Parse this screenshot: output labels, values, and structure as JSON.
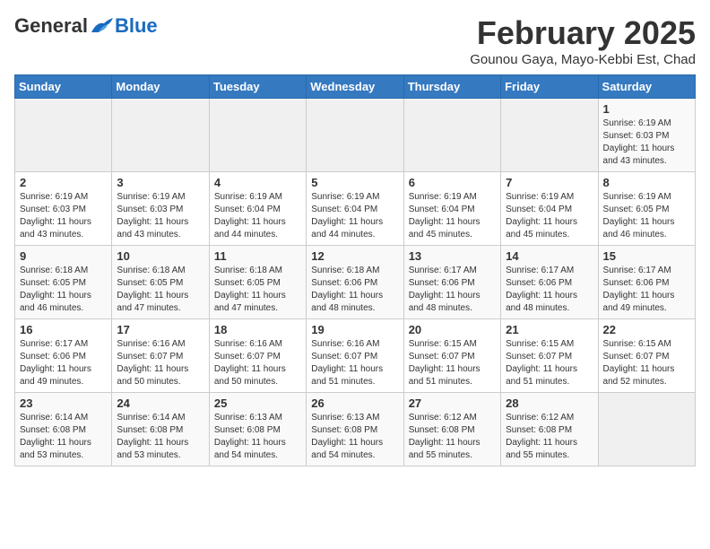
{
  "header": {
    "logo_general": "General",
    "logo_blue": "Blue",
    "month_title": "February 2025",
    "location": "Gounou Gaya, Mayo-Kebbi Est, Chad"
  },
  "weekdays": [
    "Sunday",
    "Monday",
    "Tuesday",
    "Wednesday",
    "Thursday",
    "Friday",
    "Saturday"
  ],
  "weeks": [
    [
      {
        "day": "",
        "info": ""
      },
      {
        "day": "",
        "info": ""
      },
      {
        "day": "",
        "info": ""
      },
      {
        "day": "",
        "info": ""
      },
      {
        "day": "",
        "info": ""
      },
      {
        "day": "",
        "info": ""
      },
      {
        "day": "1",
        "info": "Sunrise: 6:19 AM\nSunset: 6:03 PM\nDaylight: 11 hours\nand 43 minutes."
      }
    ],
    [
      {
        "day": "2",
        "info": "Sunrise: 6:19 AM\nSunset: 6:03 PM\nDaylight: 11 hours\nand 43 minutes."
      },
      {
        "day": "3",
        "info": "Sunrise: 6:19 AM\nSunset: 6:03 PM\nDaylight: 11 hours\nand 43 minutes."
      },
      {
        "day": "4",
        "info": "Sunrise: 6:19 AM\nSunset: 6:04 PM\nDaylight: 11 hours\nand 44 minutes."
      },
      {
        "day": "5",
        "info": "Sunrise: 6:19 AM\nSunset: 6:04 PM\nDaylight: 11 hours\nand 44 minutes."
      },
      {
        "day": "6",
        "info": "Sunrise: 6:19 AM\nSunset: 6:04 PM\nDaylight: 11 hours\nand 45 minutes."
      },
      {
        "day": "7",
        "info": "Sunrise: 6:19 AM\nSunset: 6:04 PM\nDaylight: 11 hours\nand 45 minutes."
      },
      {
        "day": "8",
        "info": "Sunrise: 6:19 AM\nSunset: 6:05 PM\nDaylight: 11 hours\nand 46 minutes."
      }
    ],
    [
      {
        "day": "9",
        "info": "Sunrise: 6:18 AM\nSunset: 6:05 PM\nDaylight: 11 hours\nand 46 minutes."
      },
      {
        "day": "10",
        "info": "Sunrise: 6:18 AM\nSunset: 6:05 PM\nDaylight: 11 hours\nand 47 minutes."
      },
      {
        "day": "11",
        "info": "Sunrise: 6:18 AM\nSunset: 6:05 PM\nDaylight: 11 hours\nand 47 minutes."
      },
      {
        "day": "12",
        "info": "Sunrise: 6:18 AM\nSunset: 6:06 PM\nDaylight: 11 hours\nand 48 minutes."
      },
      {
        "day": "13",
        "info": "Sunrise: 6:17 AM\nSunset: 6:06 PM\nDaylight: 11 hours\nand 48 minutes."
      },
      {
        "day": "14",
        "info": "Sunrise: 6:17 AM\nSunset: 6:06 PM\nDaylight: 11 hours\nand 48 minutes."
      },
      {
        "day": "15",
        "info": "Sunrise: 6:17 AM\nSunset: 6:06 PM\nDaylight: 11 hours\nand 49 minutes."
      }
    ],
    [
      {
        "day": "16",
        "info": "Sunrise: 6:17 AM\nSunset: 6:06 PM\nDaylight: 11 hours\nand 49 minutes."
      },
      {
        "day": "17",
        "info": "Sunrise: 6:16 AM\nSunset: 6:07 PM\nDaylight: 11 hours\nand 50 minutes."
      },
      {
        "day": "18",
        "info": "Sunrise: 6:16 AM\nSunset: 6:07 PM\nDaylight: 11 hours\nand 50 minutes."
      },
      {
        "day": "19",
        "info": "Sunrise: 6:16 AM\nSunset: 6:07 PM\nDaylight: 11 hours\nand 51 minutes."
      },
      {
        "day": "20",
        "info": "Sunrise: 6:15 AM\nSunset: 6:07 PM\nDaylight: 11 hours\nand 51 minutes."
      },
      {
        "day": "21",
        "info": "Sunrise: 6:15 AM\nSunset: 6:07 PM\nDaylight: 11 hours\nand 51 minutes."
      },
      {
        "day": "22",
        "info": "Sunrise: 6:15 AM\nSunset: 6:07 PM\nDaylight: 11 hours\nand 52 minutes."
      }
    ],
    [
      {
        "day": "23",
        "info": "Sunrise: 6:14 AM\nSunset: 6:08 PM\nDaylight: 11 hours\nand 53 minutes."
      },
      {
        "day": "24",
        "info": "Sunrise: 6:14 AM\nSunset: 6:08 PM\nDaylight: 11 hours\nand 53 minutes."
      },
      {
        "day": "25",
        "info": "Sunrise: 6:13 AM\nSunset: 6:08 PM\nDaylight: 11 hours\nand 54 minutes."
      },
      {
        "day": "26",
        "info": "Sunrise: 6:13 AM\nSunset: 6:08 PM\nDaylight: 11 hours\nand 54 minutes."
      },
      {
        "day": "27",
        "info": "Sunrise: 6:12 AM\nSunset: 6:08 PM\nDaylight: 11 hours\nand 55 minutes."
      },
      {
        "day": "28",
        "info": "Sunrise: 6:12 AM\nSunset: 6:08 PM\nDaylight: 11 hours\nand 55 minutes."
      },
      {
        "day": "",
        "info": ""
      }
    ]
  ]
}
